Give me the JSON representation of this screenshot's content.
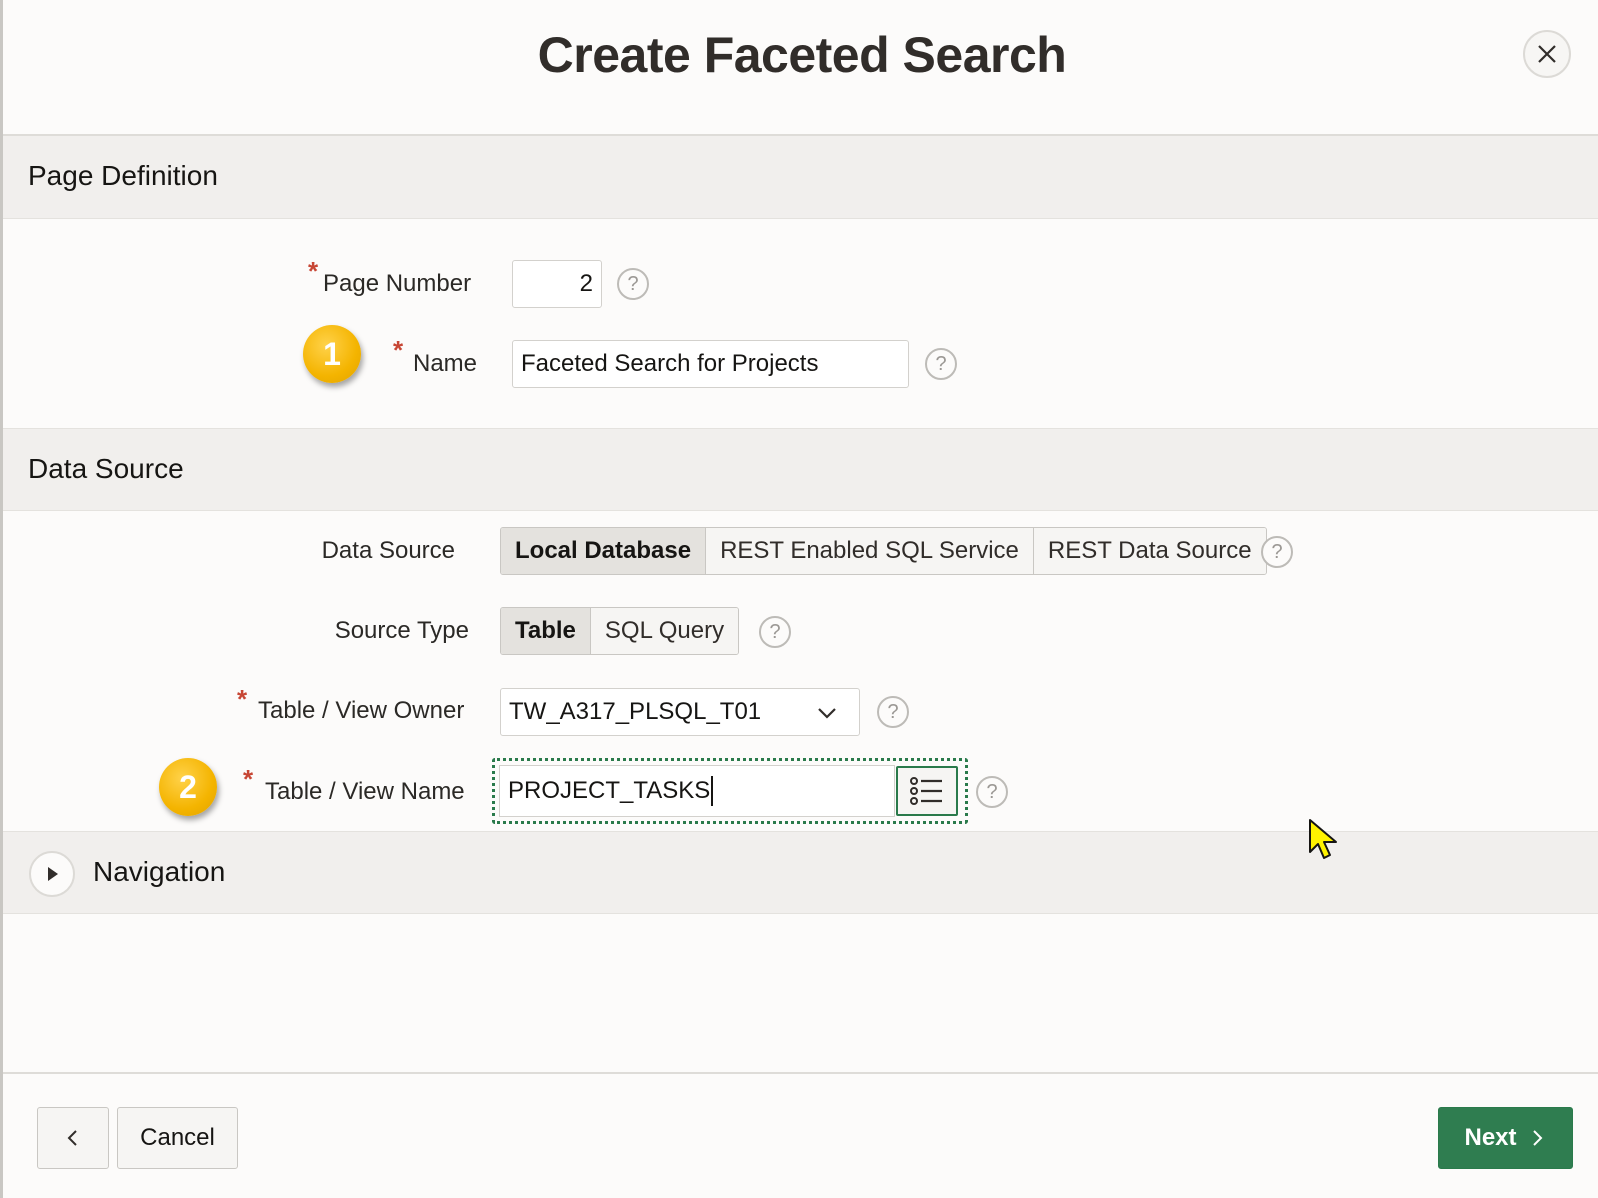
{
  "dialog": {
    "title": "Create Faceted Search",
    "close_label": "×"
  },
  "page_definition": {
    "title": "Page Definition",
    "page_number_label": "Page Number",
    "page_number_value": "2",
    "name_label": "Name",
    "name_value": "Faceted Search for Projects",
    "badge_1": "1"
  },
  "data_source": {
    "title": "Data Source",
    "data_source_label": "Data Source",
    "data_source_options": [
      "Local Database",
      "REST Enabled SQL Service",
      "REST Data Source"
    ],
    "data_source_selected": "Local Database",
    "source_type_label": "Source Type",
    "source_type_options": [
      "Table",
      "SQL Query"
    ],
    "source_type_selected": "Table",
    "owner_label": "Table / View Owner",
    "owner_value": "TW_A317_PLSQL_T01",
    "view_name_label": "Table / View Name",
    "view_name_value": "PROJECT_TASKS",
    "badge_2": "2"
  },
  "navigation": {
    "title": "Navigation"
  },
  "footer": {
    "cancel_label": "Cancel",
    "next_label": "Next"
  },
  "help_glyph": "?",
  "required_glyph": "*",
  "colors": {
    "accent": "#2f7d50",
    "required": "#c74634",
    "badge": "#f4b400"
  }
}
